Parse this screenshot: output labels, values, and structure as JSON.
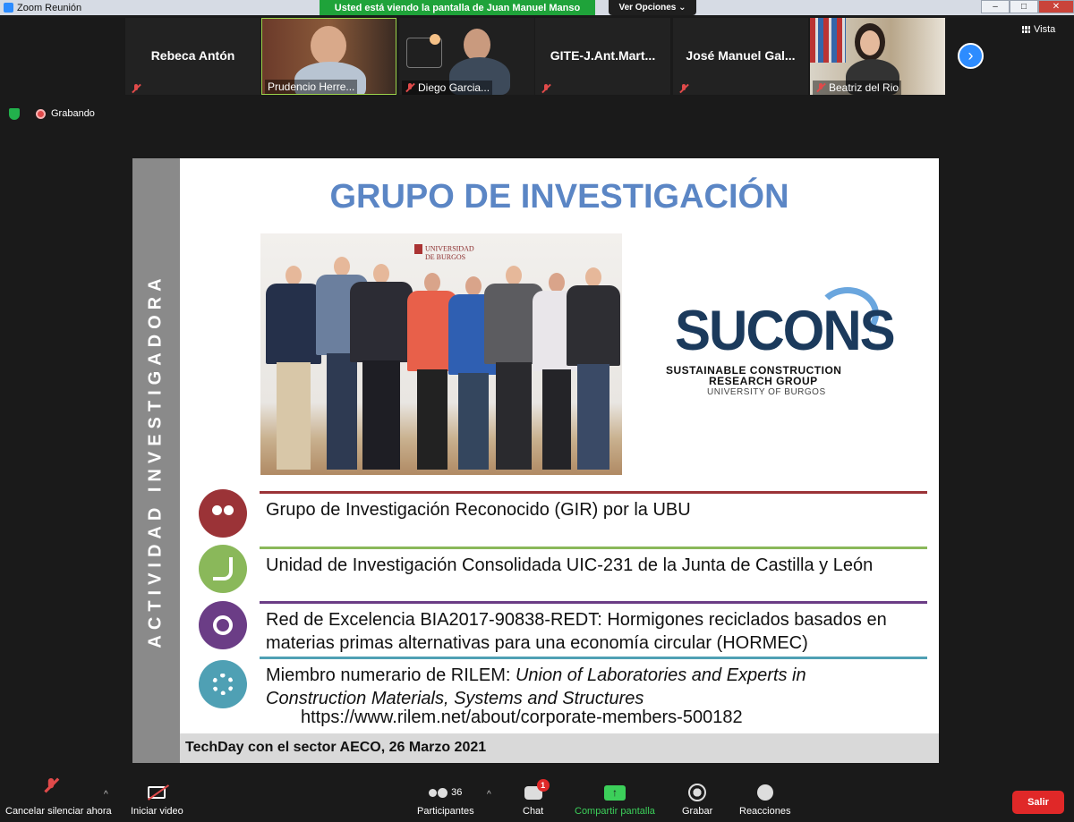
{
  "window": {
    "title": "Zoom Reunión",
    "share_banner": "Usted está viendo la pantalla de Juan Manuel Manso",
    "view_options": "Ver Opciones",
    "minimize": "–",
    "maximize": "□",
    "close": "✕"
  },
  "gallery": {
    "participants": [
      {
        "name": "Rebeca Antón",
        "has_video": false,
        "muted": true
      },
      {
        "name": "Prudencio Herre...",
        "has_video": true,
        "muted": false
      },
      {
        "name": "Diego Garcia...",
        "has_video": true,
        "muted": true
      },
      {
        "name": "GITE-J.Ant.Mart...",
        "has_video": false,
        "muted": true
      },
      {
        "name": "José Manuel Gal...",
        "has_video": false,
        "muted": true
      },
      {
        "name": "Beatriz del Rio",
        "has_video": true,
        "muted": true
      }
    ],
    "next_arrow": "›",
    "view_label": "Vista",
    "recording_label": "Grabando"
  },
  "slide": {
    "side_label": "ACTIVIDAD INVESTIGADORA",
    "title": "GRUPO DE INVESTIGACIÓN",
    "photo_logo_line1": "UNIVERSIDAD",
    "photo_logo_line2": "DE BURGOS",
    "sucons": {
      "word": "SUCONS",
      "line1": "SUSTAINABLE CONSTRUCTION",
      "line2": "RESEARCH GROUP",
      "line3": "UNIVERSITY OF BURGOS"
    },
    "items": [
      {
        "text": "Grupo de Investigación Reconocido (GIR) por la UBU",
        "color": "#9b3337",
        "icon": "users-icon"
      },
      {
        "text": "Unidad de Investigación Consolidada UIC-231 de la Junta de Castilla y León",
        "color": "#8ab85a",
        "icon": "microscope-icon"
      },
      {
        "text_line1": "Red de Excelencia BIA2017-90838-REDT: Hormigones reciclados basados en",
        "text_line2": "materias primas alternativas para una economía circular (HORMEC)",
        "color": "#6b3d86",
        "icon": "award-icon"
      },
      {
        "prefix": "Miembro numerario de RILEM: ",
        "italic1": "Union of Laboratories and Experts in",
        "italic2": "Construction Materials, Systems and Structures",
        "color": "#4fa0b4",
        "icon": "gears-icon"
      }
    ],
    "rilem_link": "https://www.rilem.net/about/corporate-members-500182",
    "footer": "TechDay con el sector AECO, 26 Marzo 2021",
    "colors": {
      "title": "#5b86c5",
      "side_band": "#8a8a8a",
      "sucons_dark": "#1b3a5c",
      "sucons_light": "#6aa6de"
    }
  },
  "toolbar": {
    "unmute": "Cancelar silenciar ahora",
    "video": "Iniciar video",
    "participants": "Participantes",
    "participants_count": "36",
    "chat": "Chat",
    "chat_badge": "1",
    "share": "Compartir pantalla",
    "record": "Grabar",
    "reactions": "Reacciones",
    "leave": "Salir",
    "caret": "^"
  }
}
